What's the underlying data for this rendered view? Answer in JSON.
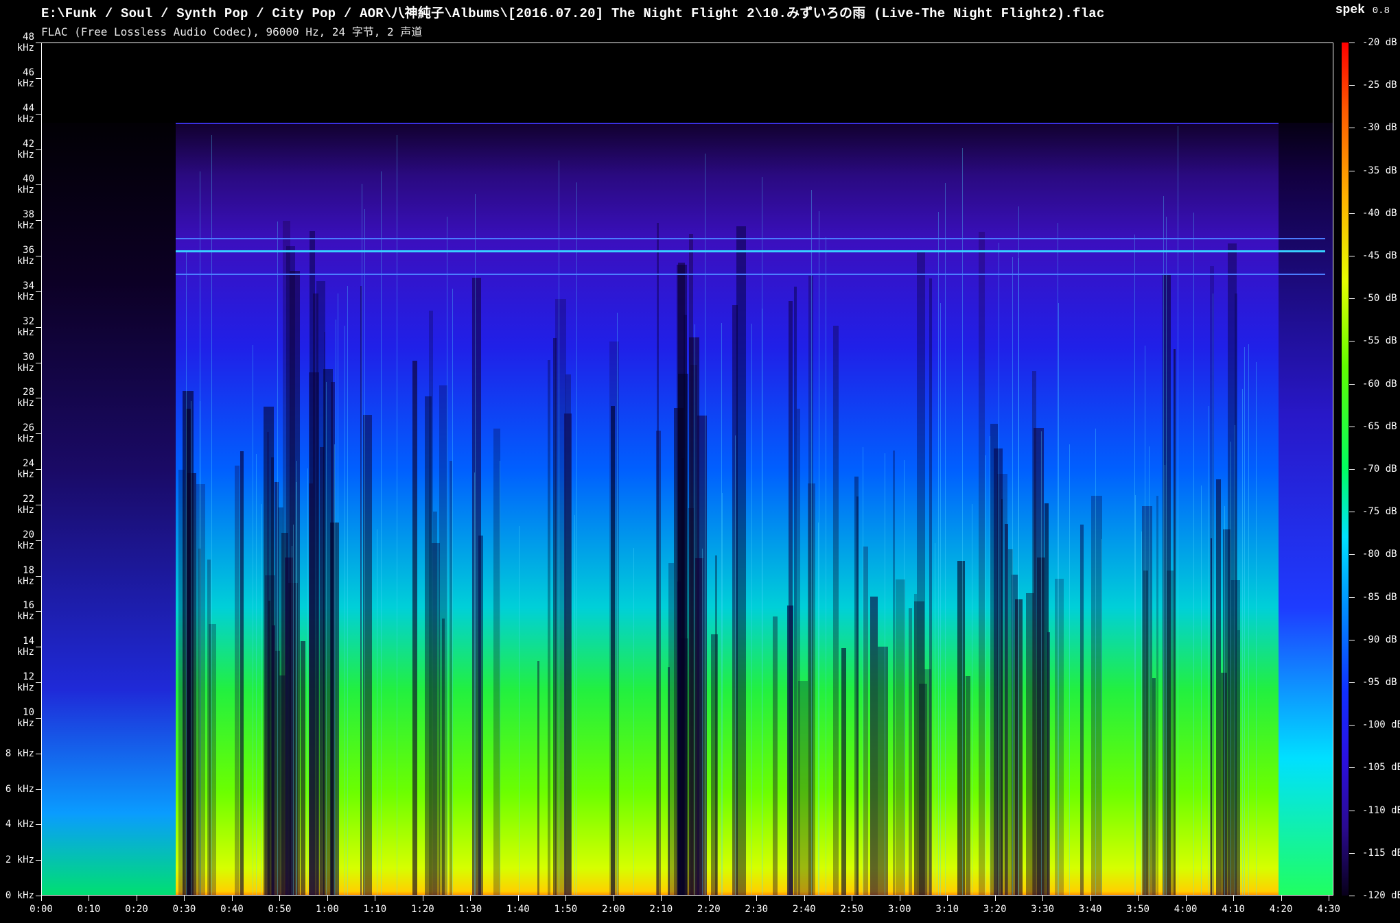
{
  "window": {
    "file_path": "E:\\Funk / Soul / Synth Pop / City Pop / AOR\\八神純子\\Albums\\[2016.07.20] The Night Flight 2\\10.みずいろの雨 (Live-The Night Flight2).flac",
    "app_name": "spek",
    "app_version": "0.8",
    "format_info": "FLAC (Free Lossless Audio Codec), 96000 Hz, 24 字节, 2 声道"
  },
  "chart_data": {
    "type": "heatmap",
    "title": "",
    "xlabel": "",
    "ylabel": "",
    "x_ticks": [
      "0:00",
      "0:10",
      "0:20",
      "0:30",
      "0:40",
      "0:50",
      "1:00",
      "1:10",
      "1:20",
      "1:30",
      "1:40",
      "1:50",
      "2:00",
      "2:10",
      "2:20",
      "2:30",
      "2:40",
      "2:50",
      "3:00",
      "3:10",
      "3:20",
      "3:30",
      "3:40",
      "3:50",
      "4:00",
      "4:10",
      "4:20",
      "4:30"
    ],
    "x_range_seconds": [
      0,
      271
    ],
    "y_ticks": [
      "0 kHz",
      "2 kHz",
      "4 kHz",
      "6 kHz",
      "8 kHz",
      "10 kHz",
      "12 kHz",
      "14 kHz",
      "16 kHz",
      "18 kHz",
      "20 kHz",
      "22 kHz",
      "24 kHz",
      "26 kHz",
      "28 kHz",
      "30 kHz",
      "32 kHz",
      "34 kHz",
      "36 kHz",
      "38 kHz",
      "40 kHz",
      "42 kHz",
      "44 kHz",
      "46 kHz",
      "48 kHz"
    ],
    "y_range_khz": [
      0,
      48
    ],
    "colorbar_ticks": [
      "-20 dB",
      "-25 dB",
      "-30 dB",
      "-35 dB",
      "-40 dB",
      "-45 dB",
      "-50 dB",
      "-55 dB",
      "-60 dB",
      "-65 dB",
      "-70 dB",
      "-75 dB",
      "-80 dB",
      "-85 dB",
      "-90 dB",
      "-95 dB",
      "-100 dB",
      "-105 dB",
      "-110 dB",
      "-115 dB",
      "-120 dB"
    ],
    "colorbar_range_db": [
      -120,
      -20
    ],
    "content_cutoff_khz": 43.5,
    "tone_lines_khz": [
      35,
      36.3,
      37
    ],
    "colormap": [
      "#08001a",
      "#2a0a90",
      "#1030ff",
      "#00e0ff",
      "#00ff60",
      "#e6ff00",
      "#ffb000",
      "#ff0000"
    ]
  }
}
